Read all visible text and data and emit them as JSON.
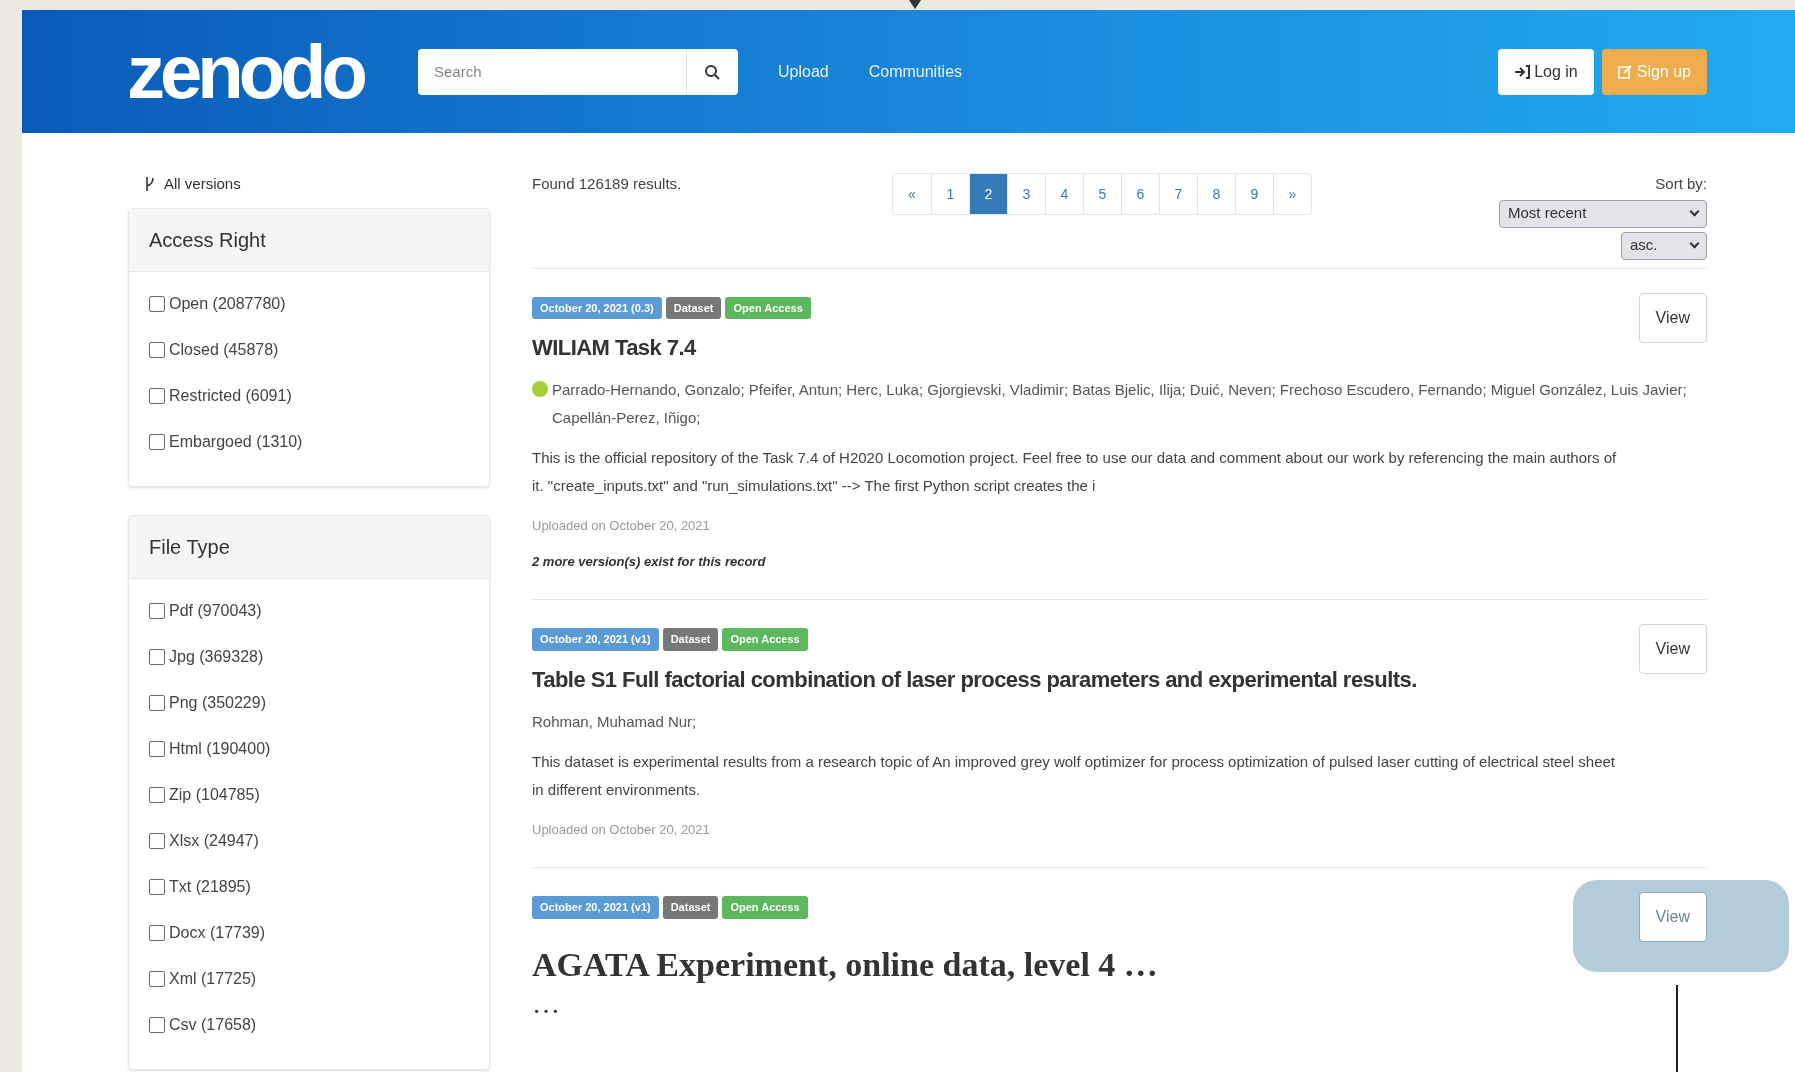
{
  "header": {
    "logo": "zenodo",
    "search": {
      "placeholder": "Search"
    },
    "nav": [
      "Upload",
      "Communities"
    ],
    "login": "Log in",
    "signup": "Sign up"
  },
  "sidebar": {
    "all_versions": "All versions",
    "facets": [
      {
        "title": "Access Right",
        "options": [
          {
            "label": "Open (2087780)",
            "checked": false
          },
          {
            "label": "Closed (45878)",
            "checked": false
          },
          {
            "label": "Restricted (6091)",
            "checked": false
          },
          {
            "label": "Embargoed (1310)",
            "checked": false
          }
        ]
      },
      {
        "title": "File Type",
        "options": [
          {
            "label": "Pdf (970043)",
            "checked": false
          },
          {
            "label": "Jpg (369328)",
            "checked": false
          },
          {
            "label": "Png (350229)",
            "checked": false
          },
          {
            "label": "Html (190400)",
            "checked": false
          },
          {
            "label": "Zip (104785)",
            "checked": false
          },
          {
            "label": "Xlsx (24947)",
            "checked": false
          },
          {
            "label": "Txt (21895)",
            "checked": false
          },
          {
            "label": "Docx (17739)",
            "checked": false
          },
          {
            "label": "Xml (17725)",
            "checked": false
          },
          {
            "label": "Csv (17658)",
            "checked": false
          }
        ]
      }
    ]
  },
  "results_header": {
    "found": "Found 126189 results.",
    "pagination": [
      {
        "label": "«",
        "selected": false
      },
      {
        "label": "1",
        "selected": false
      },
      {
        "label": "2",
        "selected": true
      },
      {
        "label": "3",
        "selected": false
      },
      {
        "label": "4",
        "selected": false
      },
      {
        "label": "5",
        "selected": false
      },
      {
        "label": "6",
        "selected": false
      },
      {
        "label": "7",
        "selected": false
      },
      {
        "label": "8",
        "selected": false
      },
      {
        "label": "9",
        "selected": false
      },
      {
        "label": "»",
        "selected": false
      }
    ],
    "sort_label": "Sort by:",
    "sort": "Most recent",
    "order": "asc."
  },
  "results": [
    {
      "badges": [
        {
          "text": "October 20, 2021 (0.3)",
          "color": "#5b9bd5"
        },
        {
          "text": "Dataset",
          "color": "#777777"
        },
        {
          "text": "Open Access",
          "color": "#5cb85c"
        }
      ],
      "title": "WILIAM Task 7.4",
      "kind": "sans",
      "orcid": true,
      "authors": "Parrado-Hernando, Gonzalo; Pfeifer, Antun; Herc, Luka; Gjorgievski, Vladimir; Batas Bjelic, Ilija; Duić, Neven; Frechoso Escudero, Fernando; Miguel González, Luis Javier; Capellán-Perez, Iñigo;",
      "description": "This is the official repository of the Task 7.4 of H2020 Locomotion project. Feel free to use our data and comment about our work by referencing the main authors of it. \"create_inputs.txt\" and \"run_simulations.txt\" --> The first Python script creates the i",
      "uploaded": "Uploaded on October 20, 2021",
      "versions": "2 more version(s) exist for this record",
      "view": "View"
    },
    {
      "badges": [
        {
          "text": "October 20, 2021 (v1)",
          "color": "#5b9bd5"
        },
        {
          "text": "Dataset",
          "color": "#777777"
        },
        {
          "text": "Open Access",
          "color": "#5cb85c"
        }
      ],
      "title": "Table S1 Full factorial combination of laser process parameters and experimental results.",
      "kind": "sans",
      "orcid": false,
      "authors": "Rohman, Muhamad Nur;",
      "description": "This dataset is experimental results from a research topic of An improved grey wolf optimizer for process optimization of pulsed laser cutting of electrical steel sheet in different environments.",
      "uploaded": "Uploaded on October 20, 2021",
      "view": "View"
    },
    {
      "badges": [
        {
          "text": "October 20, 2021 (v1)",
          "color": "#5b9bd5"
        },
        {
          "text": "Dataset",
          "color": "#777777"
        },
        {
          "text": "Open Access",
          "color": "#5cb85c"
        }
      ],
      "title": "AGATA Experiment, online data, level 4 …",
      "kind": "serif",
      "more": "…",
      "view": "View",
      "highlighted": true
    }
  ]
}
